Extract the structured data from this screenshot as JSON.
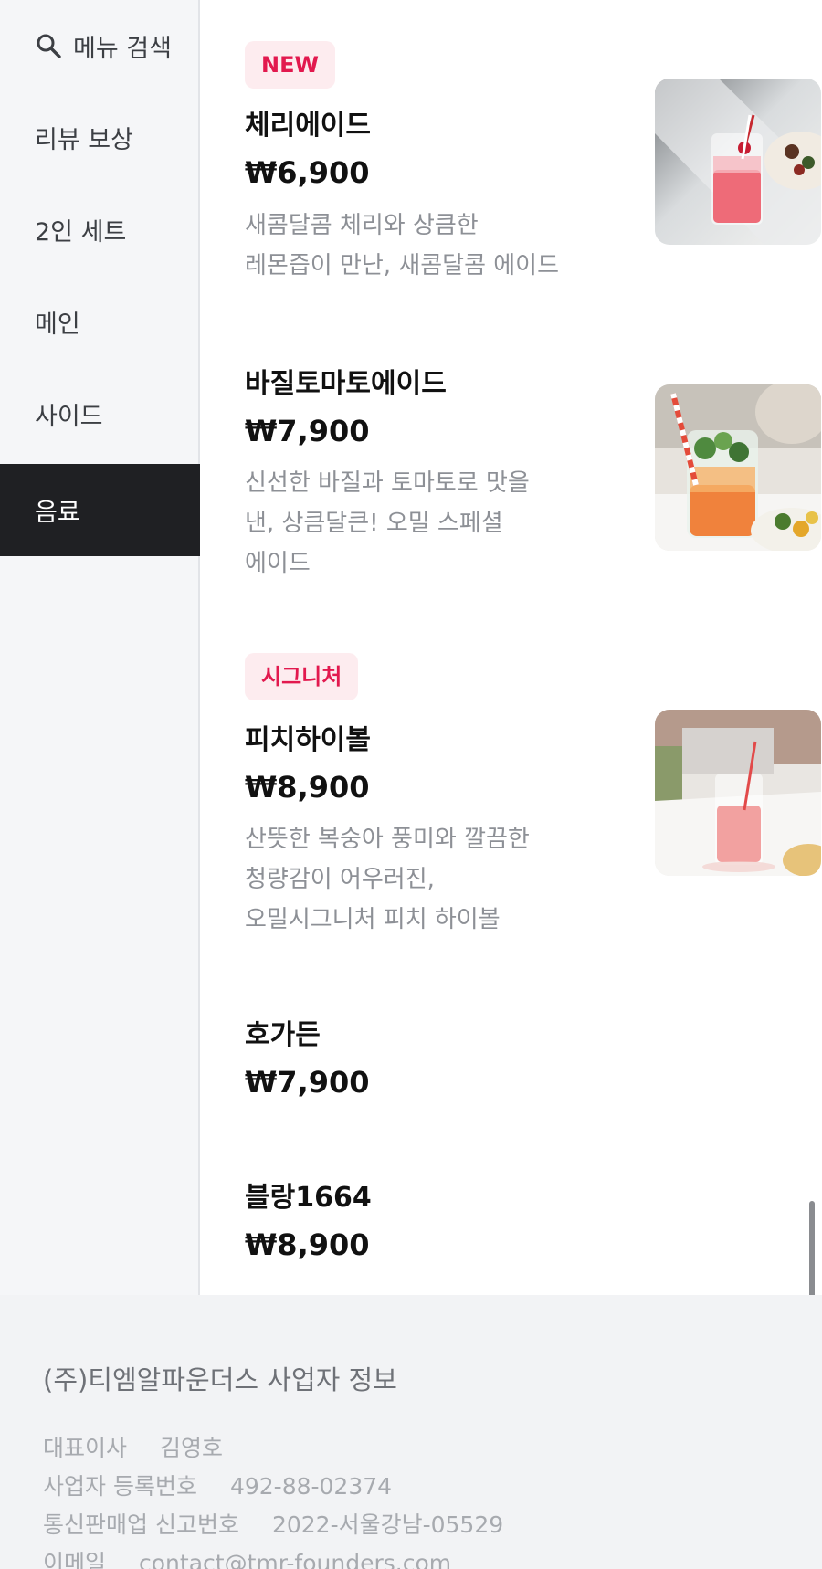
{
  "sidebar": {
    "search_label": "메뉴 검색",
    "categories": [
      {
        "label": "리뷰 보상"
      },
      {
        "label": "2인 세트"
      },
      {
        "label": "메인"
      },
      {
        "label": "사이드"
      },
      {
        "label": "음료",
        "active": true
      }
    ]
  },
  "menu": {
    "items": [
      {
        "badge": "NEW",
        "name": "체리에이드",
        "price": "₩6,900",
        "desc": "새콤달콤 체리와 상큼한 레몬즙이 만난, 새콤달콤 에이드",
        "image": "cherry-ade-photo"
      },
      {
        "name": "바질토마토에이드",
        "price": "₩7,900",
        "desc": "신선한 바질과 토마토로 맛을 낸, 상큼달큰! 오밀 스페셜 에이드",
        "image": "basil-tomato-ade-photo"
      },
      {
        "badge": "시그니처",
        "name": "피치하이볼",
        "price": "₩8,900",
        "desc": "산뜻한 복숭아 풍미와 깔끔한 청량감이 어우러진, 오밀시그니처 피치 하이볼",
        "image": "peach-highball-photo"
      },
      {
        "name": "호가든",
        "price": "₩7,900"
      },
      {
        "name": "블랑1664",
        "price": "₩8,900"
      }
    ]
  },
  "footer": {
    "title": "(주)티엠알파운더스 사업자 정보",
    "rows": [
      {
        "label": "대표이사",
        "value": "김영호"
      },
      {
        "label": "사업자 등록번호",
        "value": "492-88-02374"
      },
      {
        "label": "통신판매업 신고번호",
        "value": "2022-서울강남-05529"
      },
      {
        "label": "이메일",
        "value": "contact@tmr-founders.com"
      }
    ]
  },
  "colors": {
    "accent_badge_text": "#e2194e",
    "accent_badge_bg": "#fdecef",
    "active_category_bg": "#1f2023"
  }
}
